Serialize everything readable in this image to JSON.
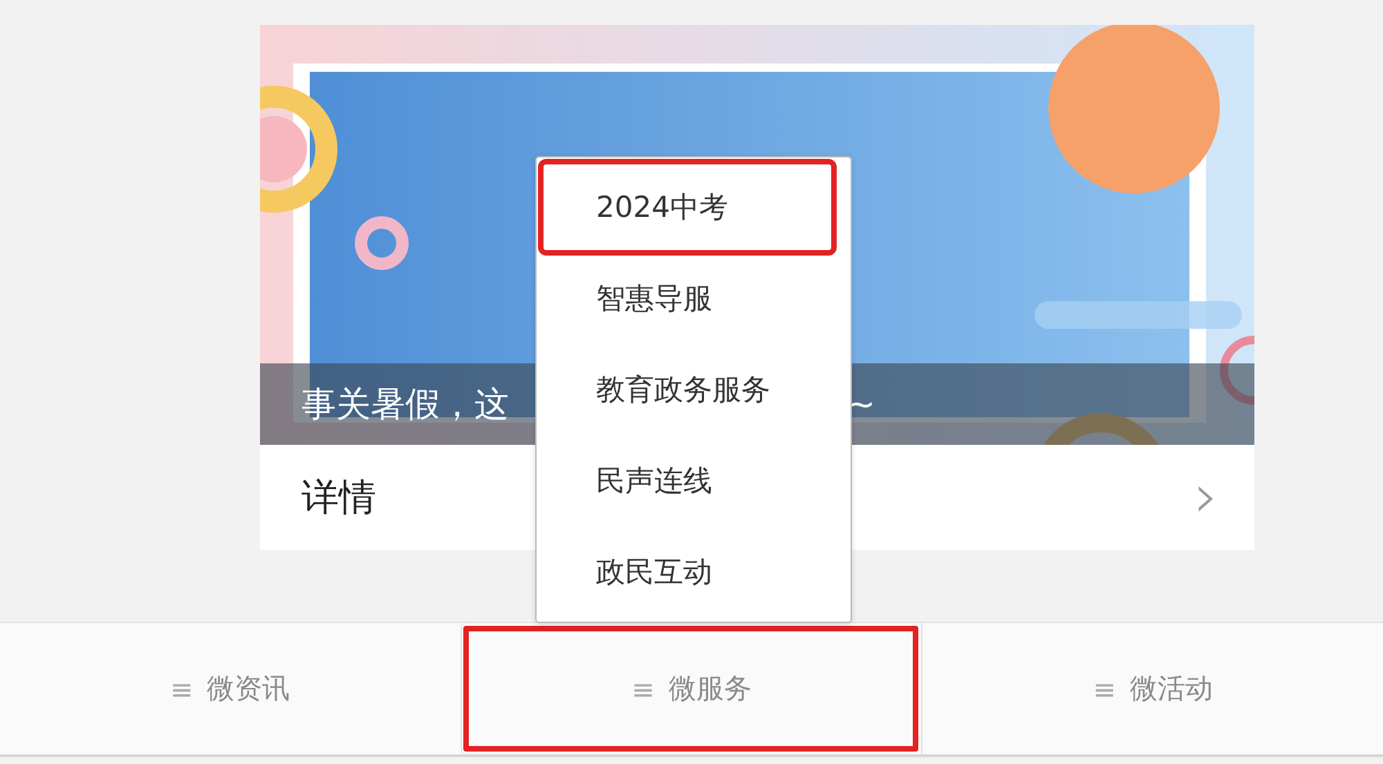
{
  "card": {
    "caption_start": "事关暑假，这",
    "caption_end": "~",
    "details_label": "详情",
    "chevron": "›"
  },
  "menu": {
    "items": [
      {
        "label": "2024中考",
        "annotated": true
      },
      {
        "label": "智惠导服",
        "annotated": false
      },
      {
        "label": "教育政务服务",
        "annotated": false
      },
      {
        "label": "民声连线",
        "annotated": false
      },
      {
        "label": "政民互动",
        "annotated": false
      }
    ]
  },
  "tabs": [
    {
      "icon": "≡",
      "label": "微资讯",
      "annotated": false
    },
    {
      "icon": "≡",
      "label": "微服务",
      "annotated": true
    },
    {
      "icon": "≡",
      "label": "微活动",
      "annotated": false
    }
  ]
}
